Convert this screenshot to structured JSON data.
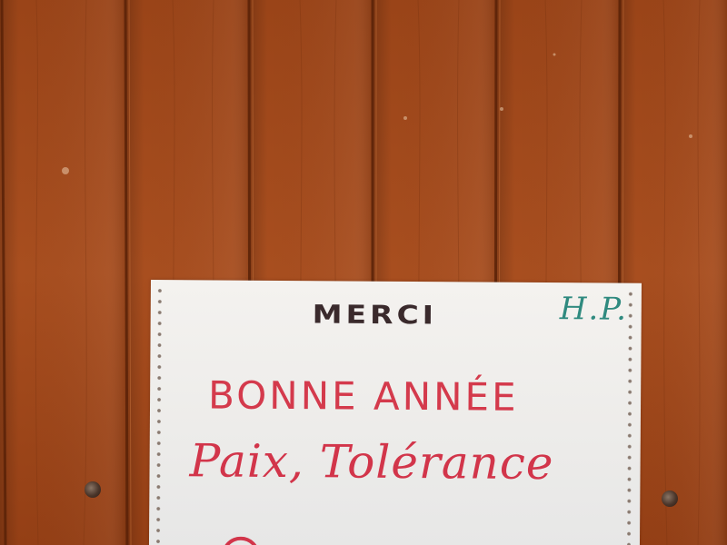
{
  "photo": {
    "subject": "paper-sign-on-wooden-door",
    "sign": {
      "header": "MERCI",
      "initials": "H.P.",
      "line1": "BONNE ANNÉE",
      "line2": "Paix, Tolérance"
    }
  },
  "colors": {
    "wood": "#a04a1c",
    "paper": "#eeecea",
    "header_ink": "#3a2a2c",
    "initials_ink": "#2f8a7f",
    "red_ink": "#d2354a"
  }
}
